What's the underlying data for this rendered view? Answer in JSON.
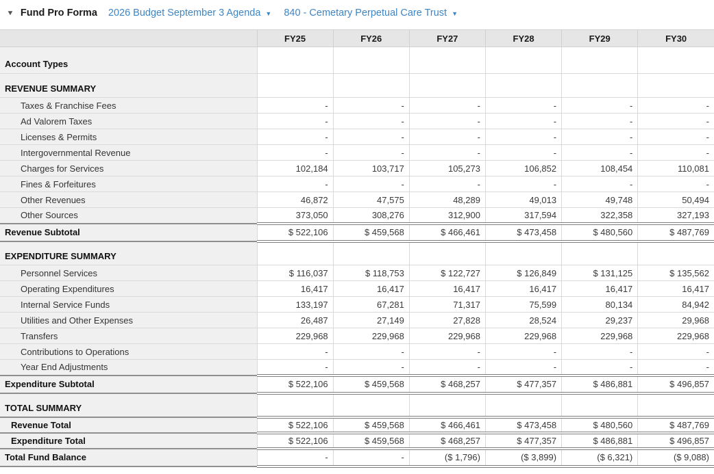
{
  "toolbar": {
    "collapse_icon": "▼",
    "title": "Fund Pro Forma",
    "budget_dropdown": {
      "label": "2026 Budget September 3 Agenda",
      "caret": "▼"
    },
    "fund_dropdown": {
      "label": "840 - Cemetary Perpetual Care Trust",
      "caret": "▼"
    }
  },
  "colors": {
    "link_blue": "#3e85c6",
    "header_row_bg": "#e6e6e6",
    "label_column_bg": "#f0f0f0",
    "gridline": "#d9d9d9",
    "double_rule": "#7d7d7d"
  },
  "table": {
    "label_column_header": "",
    "columns": [
      "FY25",
      "FY26",
      "FY27",
      "FY28",
      "FY29",
      "FY30"
    ],
    "rows": [
      {
        "label": "Account Types",
        "type": "section-tall",
        "values": [
          "",
          "",
          "",
          "",
          "",
          ""
        ]
      },
      {
        "label": "REVENUE SUMMARY",
        "type": "section",
        "values": [
          "",
          "",
          "",
          "",
          "",
          ""
        ]
      },
      {
        "label": "Taxes & Franchise Fees",
        "type": "item",
        "values": [
          "-",
          "-",
          "-",
          "-",
          "-",
          "-"
        ]
      },
      {
        "label": "Ad Valorem Taxes",
        "type": "item",
        "values": [
          "-",
          "-",
          "-",
          "-",
          "-",
          "-"
        ]
      },
      {
        "label": "Licenses & Permits",
        "type": "item",
        "values": [
          "-",
          "-",
          "-",
          "-",
          "-",
          "-"
        ]
      },
      {
        "label": "Intergovernmental Revenue",
        "type": "item",
        "values": [
          "-",
          "-",
          "-",
          "-",
          "-",
          "-"
        ]
      },
      {
        "label": "Charges for Services",
        "type": "item",
        "values": [
          "102,184",
          "103,717",
          "105,273",
          "106,852",
          "108,454",
          "110,081"
        ]
      },
      {
        "label": "Fines & Forfeitures",
        "type": "item",
        "values": [
          "-",
          "-",
          "-",
          "-",
          "-",
          "-"
        ]
      },
      {
        "label": "Other Revenues",
        "type": "item",
        "values": [
          "46,872",
          "47,575",
          "48,289",
          "49,013",
          "49,748",
          "50,494"
        ]
      },
      {
        "label": "Other Sources",
        "type": "item",
        "values": [
          "373,050",
          "308,276",
          "312,900",
          "317,594",
          "322,358",
          "327,193"
        ]
      },
      {
        "label": "Revenue Subtotal",
        "type": "subtotal",
        "values": [
          "$ 522,106",
          "$ 459,568",
          "$ 466,461",
          "$ 473,458",
          "$ 480,560",
          "$ 487,769"
        ]
      },
      {
        "label": "EXPENDITURE SUMMARY",
        "type": "section",
        "values": [
          "",
          "",
          "",
          "",
          "",
          ""
        ]
      },
      {
        "label": "Personnel Services",
        "type": "item",
        "values": [
          "$ 116,037",
          "$ 118,753",
          "$ 122,727",
          "$ 126,849",
          "$ 131,125",
          "$ 135,562"
        ]
      },
      {
        "label": "Operating Expenditures",
        "type": "item",
        "values": [
          "16,417",
          "16,417",
          "16,417",
          "16,417",
          "16,417",
          "16,417"
        ]
      },
      {
        "label": "Internal Service Funds",
        "type": "item",
        "values": [
          "133,197",
          "67,281",
          "71,317",
          "75,599",
          "80,134",
          "84,942"
        ]
      },
      {
        "label": "Utilities and Other Expenses",
        "type": "item",
        "values": [
          "26,487",
          "27,149",
          "27,828",
          "28,524",
          "29,237",
          "29,968"
        ]
      },
      {
        "label": "Transfers",
        "type": "item",
        "values": [
          "229,968",
          "229,968",
          "229,968",
          "229,968",
          "229,968",
          "229,968"
        ]
      },
      {
        "label": "Contributions to Operations",
        "type": "item",
        "values": [
          "-",
          "-",
          "-",
          "-",
          "-",
          "-"
        ]
      },
      {
        "label": "Year End Adjustments",
        "type": "item",
        "values": [
          "-",
          "-",
          "-",
          "-",
          "-",
          "-"
        ]
      },
      {
        "label": "Expenditure Subtotal",
        "type": "subtotal",
        "values": [
          "$ 522,106",
          "$ 459,568",
          "$ 468,257",
          "$ 477,357",
          "$ 486,881",
          "$ 496,857"
        ]
      },
      {
        "label": "TOTAL SUMMARY",
        "type": "section",
        "values": [
          "",
          "",
          "",
          "",
          "",
          ""
        ]
      },
      {
        "label": "Revenue Total",
        "type": "total-item",
        "values": [
          "$ 522,106",
          "$ 459,568",
          "$ 466,461",
          "$ 473,458",
          "$ 480,560",
          "$ 487,769"
        ]
      },
      {
        "label": "Expenditure Total",
        "type": "total-item",
        "values": [
          "$ 522,106",
          "$ 459,568",
          "$ 468,257",
          "$ 477,357",
          "$ 486,881",
          "$ 496,857"
        ]
      },
      {
        "label": "Total Fund Balance",
        "type": "subtotal",
        "values": [
          "-",
          "-",
          "($ 1,796)",
          "($ 3,899)",
          "($ 6,321)",
          "($ 9,088)"
        ]
      }
    ]
  }
}
